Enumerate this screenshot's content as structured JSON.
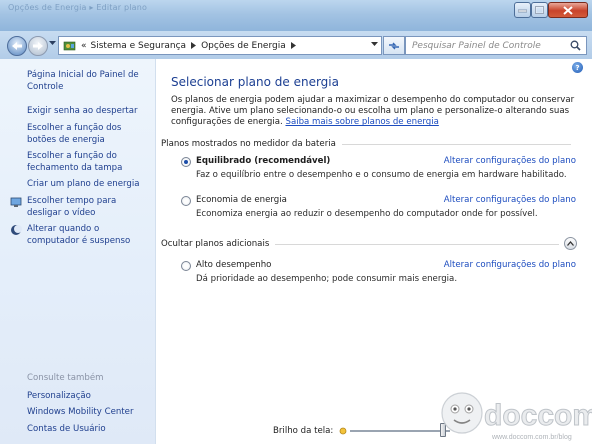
{
  "titlebar": {
    "ghost_text": "Opções de Energia ▸ Editar plano"
  },
  "address": {
    "breadcrumb": [
      "Sistema e Segurança",
      "Opções de Energia"
    ],
    "overflow": "«",
    "search_placeholder": "Pesquisar Painel de Controle"
  },
  "sidebar": {
    "home": "Página Inicial do Painel de Controle",
    "links": [
      {
        "label": "Exigir senha ao despertar",
        "icon": ""
      },
      {
        "label": "Escolher a função dos botões de energia",
        "icon": ""
      },
      {
        "label": "Escolher a função do fechamento da tampa",
        "icon": ""
      },
      {
        "label": "Criar um plano de energia",
        "icon": ""
      },
      {
        "label": "Escolher tempo para desligar o vídeo",
        "icon": "monitor-icon"
      },
      {
        "label": "Alterar quando o computador é suspenso",
        "icon": "moon-icon"
      }
    ],
    "see_also_title": "Consulte também",
    "see_also": [
      "Personalização",
      "Windows Mobility Center",
      "Contas de Usuário"
    ]
  },
  "main": {
    "title": "Selecionar plano de energia",
    "intro": "Os planos de energia podem ajudar a maximizar o desempenho do computador ou conservar energia. Ative um plano selecionando-o ou escolha um plano e personalize-o alterando suas configurações de energia.",
    "intro_link": "Saiba mais sobre planos de energia",
    "section_battery": "Planos mostrados no medidor da bateria",
    "section_hidden": "Ocultar planos adicionais",
    "change_settings": "Alterar configurações do plano",
    "plans": [
      {
        "name": "Equilibrado (recomendável)",
        "desc": "Faz o equilíbrio entre o desempenho e o consumo de energia em hardware habilitado.",
        "selected": true
      },
      {
        "name": "Economia de energia",
        "desc": "Economiza energia ao reduzir o desempenho do computador onde for possível.",
        "selected": false
      },
      {
        "name": "Alto desempenho",
        "desc": "Dá prioridade ao desempenho; pode consumir mais energia.",
        "selected": false
      }
    ],
    "brightness_label": "Brilho da tela:",
    "brightness_level": 0.93
  },
  "watermark": {
    "text": "doccom",
    "sub": "www.doccom.com.br/blog"
  },
  "colors": {
    "link": "#1c4cbf",
    "title": "#1c3f92",
    "sidebar_link": "#1f3f8e"
  }
}
